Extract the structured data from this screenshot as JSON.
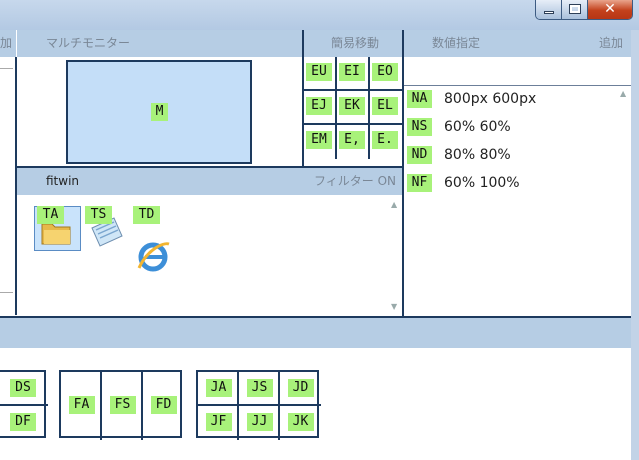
{
  "window": {
    "minimize_label": "",
    "close_glyph": "✕"
  },
  "left_header": {
    "text": "加"
  },
  "multimonitor": {
    "title": "マルチモニター",
    "monitor_key": "M"
  },
  "quick_move": {
    "title": "簡易移動",
    "keys": [
      "EU",
      "EI",
      "EO",
      "EJ",
      "EK",
      "EL",
      "EM",
      "E,",
      "E."
    ]
  },
  "numeric": {
    "title": "数値指定",
    "add_label": "追加",
    "input_value": "",
    "rows": [
      {
        "key": "NA",
        "value": "800px 600px"
      },
      {
        "key": "NS",
        "value": "60% 60%"
      },
      {
        "key": "ND",
        "value": "80% 80%"
      },
      {
        "key": "NF",
        "value": "60% 100%"
      }
    ]
  },
  "fitwin": {
    "title": "fitwin",
    "filter_label": "フィルター ON",
    "apps": [
      {
        "key": "TA",
        "icon": "folder-icon"
      },
      {
        "key": "TS",
        "icon": "notepad-icon"
      },
      {
        "key": "TD",
        "icon": "ie-icon"
      }
    ]
  },
  "bottom": {
    "group1": [
      "DS",
      "DF"
    ],
    "group2": [
      "FA",
      "FS",
      "FD"
    ],
    "group3": [
      "JA",
      "JS",
      "JD",
      "JF",
      "JJ",
      "JK"
    ]
  }
}
